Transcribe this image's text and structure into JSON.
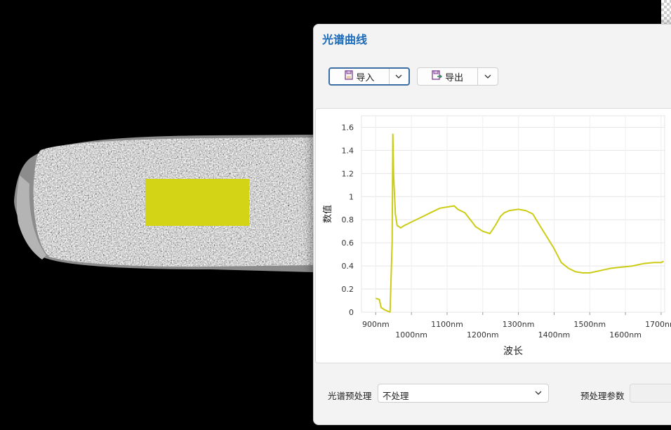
{
  "panel": {
    "title": "光谱曲线",
    "import_label": "导入",
    "export_label": "导出"
  },
  "roi": {
    "color": "#d4d417"
  },
  "chart_data": {
    "type": "line",
    "xlabel": "波长",
    "ylabel": "数值",
    "x_tick_labels": [
      "900nm",
      "1000nm",
      "1100nm",
      "1200nm",
      "1300nm",
      "1400nm",
      "1500nm",
      "1600nm",
      "1700nm"
    ],
    "y_tick_labels": [
      "0",
      "0.2",
      "0.4",
      "0.6",
      "0.8",
      "1",
      "1.2",
      "1.4",
      "1.6"
    ],
    "xlim": [
      860,
      1710
    ],
    "ylim": [
      0,
      1.7
    ],
    "grid": true,
    "series": [
      {
        "color": "#cccc14",
        "x": [
          900,
          910,
          915,
          925,
          940,
          946,
          948,
          950,
          955,
          960,
          970,
          980,
          1000,
          1020,
          1040,
          1060,
          1080,
          1100,
          1120,
          1130,
          1150,
          1170,
          1180,
          1200,
          1220,
          1235,
          1250,
          1260,
          1275,
          1300,
          1320,
          1340,
          1360,
          1380,
          1400,
          1420,
          1440,
          1460,
          1480,
          1500,
          1530,
          1560,
          1590,
          1620,
          1650,
          1680,
          1700,
          1707
        ],
        "y": [
          0.12,
          0.11,
          0.04,
          0.02,
          0.0,
          0.6,
          1.54,
          1.2,
          0.85,
          0.75,
          0.73,
          0.75,
          0.78,
          0.81,
          0.84,
          0.87,
          0.9,
          0.91,
          0.92,
          0.89,
          0.86,
          0.78,
          0.74,
          0.7,
          0.68,
          0.75,
          0.83,
          0.86,
          0.88,
          0.89,
          0.88,
          0.85,
          0.75,
          0.65,
          0.55,
          0.43,
          0.38,
          0.35,
          0.34,
          0.34,
          0.36,
          0.38,
          0.39,
          0.4,
          0.42,
          0.43,
          0.43,
          0.44
        ]
      }
    ]
  },
  "bottom": {
    "preprocess_label": "光谱预处理",
    "preprocess_value": "不处理",
    "params_label": "预处理参数"
  }
}
